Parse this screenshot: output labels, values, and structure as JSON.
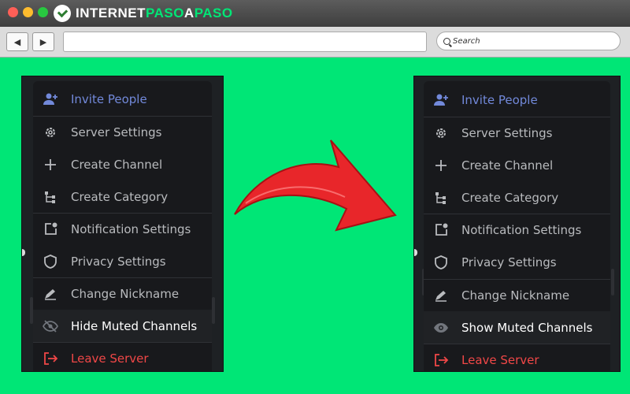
{
  "brand": {
    "part1": "INTERNET",
    "part2": "PASO",
    "part3": "A",
    "part4": "PASO"
  },
  "browser": {
    "back_icon": "◀",
    "forward_icon": "▶",
    "search_placeholder": "Search"
  },
  "menu_before": {
    "items": [
      {
        "label": "Invite People",
        "icon": "add-user-icon"
      },
      {
        "label": "Server Settings",
        "icon": "gear-icon"
      },
      {
        "label": "Create Channel",
        "icon": "plus-icon"
      },
      {
        "label": "Create Category",
        "icon": "category-icon"
      },
      {
        "label": "Notification Settings",
        "icon": "bell-icon"
      },
      {
        "label": "Privacy Settings",
        "icon": "shield-icon"
      },
      {
        "label": "Change Nickname",
        "icon": "pencil-icon"
      },
      {
        "label": "Hide Muted Channels",
        "icon": "eye-off-icon"
      },
      {
        "label": "Leave Server",
        "icon": "leave-icon"
      }
    ]
  },
  "menu_after": {
    "items": [
      {
        "label": "Invite People",
        "icon": "add-user-icon"
      },
      {
        "label": "Server Settings",
        "icon": "gear-icon"
      },
      {
        "label": "Create Channel",
        "icon": "plus-icon"
      },
      {
        "label": "Create Category",
        "icon": "category-icon"
      },
      {
        "label": "Notification Settings",
        "icon": "bell-icon"
      },
      {
        "label": "Privacy Settings",
        "icon": "shield-icon"
      },
      {
        "label": "Change Nickname",
        "icon": "pencil-icon"
      },
      {
        "label": "Show Muted Channels",
        "icon": "eye-icon"
      },
      {
        "label": "Leave Server",
        "icon": "leave-icon"
      }
    ]
  },
  "colors": {
    "background": "#00e676",
    "accent_blue": "#7289da",
    "danger_red": "#f04747",
    "menu_bg": "#18191c",
    "arrow_red": "#e8262a"
  }
}
